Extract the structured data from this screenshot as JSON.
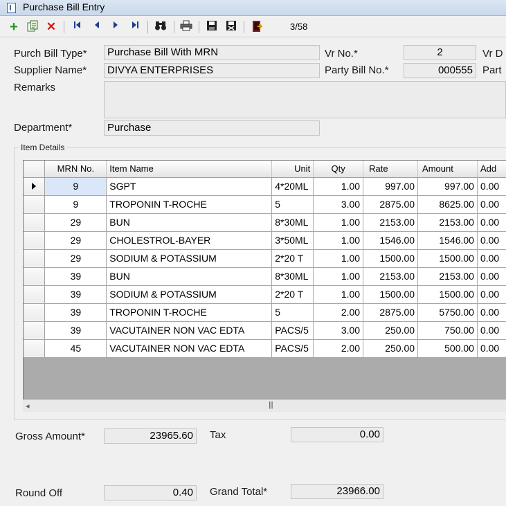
{
  "window": {
    "title": "Purchase Bill Entry"
  },
  "toolbar": {
    "icons": [
      "add-icon",
      "copy-document-icon",
      "delete-icon",
      "first-record-icon",
      "previous-record-icon",
      "next-record-icon",
      "last-record-icon",
      "find-binoculars-icon",
      "print-icon",
      "save-icon",
      "save-close-icon",
      "exit-icon"
    ],
    "record_position": "3/58"
  },
  "header": {
    "bill_type_label": "Purch Bill Type*",
    "bill_type_value": "Purchase Bill With MRN",
    "supplier_label": "Supplier Name*",
    "supplier_value": "DIVYA ENTERPRISES",
    "remarks_label": "Remarks",
    "remarks_value": "",
    "department_label": "Department*",
    "department_value": "Purchase",
    "vr_no_label": "Vr No.*",
    "vr_no_value": "2",
    "party_bill_label": "Party Bill No.*",
    "party_bill_value": "000555",
    "vr_date_label": "Vr D",
    "party_date_label": "Part"
  },
  "items": {
    "group_title": "Item Details",
    "columns": [
      "MRN No.",
      "Item Name",
      "Unit",
      "Qty",
      "Rate",
      "Amount",
      "Add"
    ],
    "rows": [
      {
        "mrn": "9",
        "item": "SGPT",
        "unit": "4*20ML",
        "qty": "1.00",
        "rate": "997.00",
        "amount": "997.00",
        "add": "0.00"
      },
      {
        "mrn": "9",
        "item": "TROPONIN T-ROCHE",
        "unit": "5",
        "qty": "3.00",
        "rate": "2875.00",
        "amount": "8625.00",
        "add": "0.00"
      },
      {
        "mrn": "29",
        "item": "BUN",
        "unit": "8*30ML",
        "qty": "1.00",
        "rate": "2153.00",
        "amount": "2153.00",
        "add": "0.00"
      },
      {
        "mrn": "29",
        "item": "CHOLESTROL-BAYER",
        "unit": "3*50ML",
        "qty": "1.00",
        "rate": "1546.00",
        "amount": "1546.00",
        "add": "0.00"
      },
      {
        "mrn": "29",
        "item": "SODIUM & POTASSIUM",
        "unit": "2*20 T",
        "qty": "1.00",
        "rate": "1500.00",
        "amount": "1500.00",
        "add": "0.00"
      },
      {
        "mrn": "39",
        "item": "BUN",
        "unit": "8*30ML",
        "qty": "1.00",
        "rate": "2153.00",
        "amount": "2153.00",
        "add": "0.00"
      },
      {
        "mrn": "39",
        "item": "SODIUM & POTASSIUM",
        "unit": "2*20 T",
        "qty": "1.00",
        "rate": "1500.00",
        "amount": "1500.00",
        "add": "0.00"
      },
      {
        "mrn": "39",
        "item": "TROPONIN T-ROCHE",
        "unit": "5",
        "qty": "2.00",
        "rate": "2875.00",
        "amount": "5750.00",
        "add": "0.00"
      },
      {
        "mrn": "39",
        "item": "VACUTAINER NON VAC EDTA",
        "unit": "PACS/5",
        "qty": "3.00",
        "rate": "250.00",
        "amount": "750.00",
        "add": "0.00"
      },
      {
        "mrn": "45",
        "item": "VACUTAINER NON VAC EDTA",
        "unit": "PACS/5",
        "qty": "2.00",
        "rate": "250.00",
        "amount": "500.00",
        "add": "0.00"
      }
    ]
  },
  "totals": {
    "gross_label": "Gross Amount*",
    "gross_value": "23965.60",
    "tax_label": "Tax",
    "tax_value": "0.00",
    "round_off_label": "Round Off",
    "round_off_value": "0.40",
    "grand_total_label": "Grand Total*",
    "grand_total_value": "23966.00"
  },
  "colors": {
    "selected_cell": "#d9e7f9",
    "grid_empty": "#ababab",
    "add_green": "#1f9a1f",
    "delete_red": "#d21a1a"
  }
}
